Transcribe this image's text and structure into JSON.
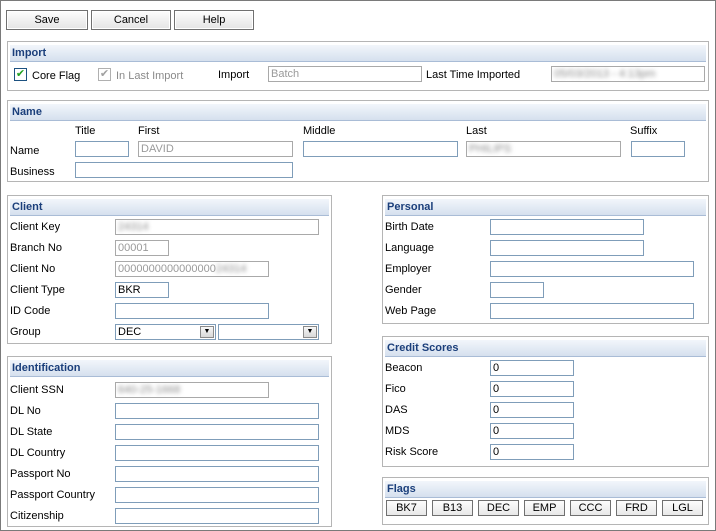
{
  "toolbar": {
    "save": "Save",
    "cancel": "Cancel",
    "help": "Help"
  },
  "import": {
    "title": "Import",
    "core_flag": "Core Flag",
    "in_last_import": "In Last Import",
    "import_label": "Import",
    "import_value": "Batch",
    "last_time_label": "Last Time Imported",
    "last_time_value": "05/03/2013 - 4:13pm"
  },
  "name": {
    "title": "Name",
    "row_label": "Name",
    "business_label": "Business",
    "col_title": "Title",
    "col_first": "First",
    "col_middle": "Middle",
    "col_last": "Last",
    "col_suffix": "Suffix",
    "title_value": "",
    "first_value": "DAVID",
    "middle_value": "",
    "last_value": "PHILIPS",
    "suffix_value": "",
    "business_value": ""
  },
  "client": {
    "title": "Client",
    "key_label": "Client Key",
    "key_value": "24314",
    "branch_label": "Branch No",
    "branch_value": "00001",
    "clientno_label": "Client No",
    "clientno_value": "0000000000000000",
    "clientno_blur": "24314",
    "type_label": "Client Type",
    "type_value": "BKR",
    "idcode_label": "ID Code",
    "idcode_value": "",
    "group_label": "Group",
    "group_value": "DEC",
    "group2_value": ""
  },
  "identification": {
    "title": "Identification",
    "ssn_label": "Client SSN",
    "ssn_value": "640-25-1668",
    "dlno_label": "DL No",
    "dlstate_label": "DL State",
    "dlcountry_label": "DL Country",
    "passport_label": "Passport No",
    "passportcountry_label": "Passport Country",
    "citizenship_label": "Citizenship"
  },
  "personal": {
    "title": "Personal",
    "birth_label": "Birth Date",
    "language_label": "Language",
    "employer_label": "Employer",
    "gender_label": "Gender",
    "web_label": "Web Page"
  },
  "credit": {
    "title": "Credit Scores",
    "beacon_label": "Beacon",
    "beacon_value": "0",
    "fico_label": "Fico",
    "fico_value": "0",
    "das_label": "DAS",
    "das_value": "0",
    "mds_label": "MDS",
    "mds_value": "0",
    "risk_label": "Risk Score",
    "risk_value": "0"
  },
  "flags": {
    "title": "Flags",
    "items": [
      "BK7",
      "B13",
      "DEC",
      "EMP",
      "CCC",
      "FRD",
      "LGL"
    ]
  }
}
